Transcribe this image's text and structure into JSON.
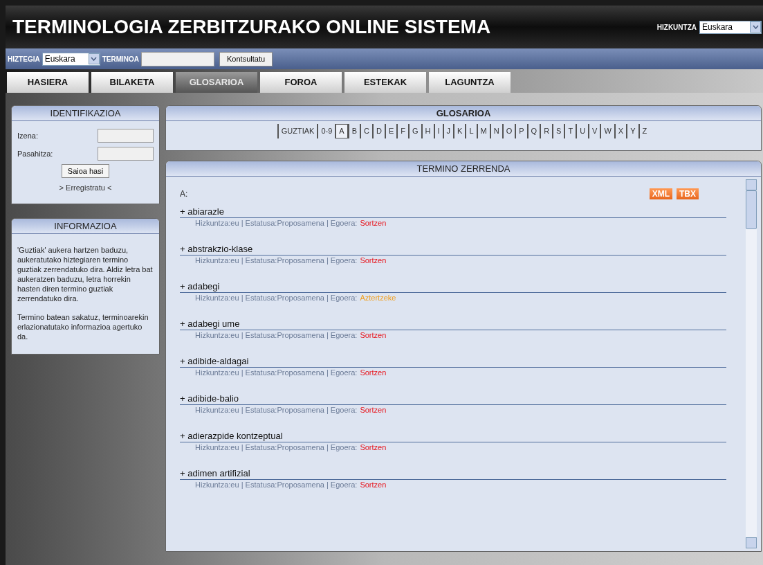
{
  "header": {
    "title": "TERMINOLOGIA ZERBITZURAKO ONLINE SISTEMA",
    "language_label": "HIZKUNTZA",
    "language_value": "Euskara"
  },
  "search_bar": {
    "dictionary_label": "HIZTEGIA",
    "dictionary_value": "Euskara",
    "term_label": "TERMINOA",
    "button": "Kontsultatu"
  },
  "tabs": [
    {
      "label": "HASIERA",
      "selected": false
    },
    {
      "label": "BILAKETA",
      "selected": false
    },
    {
      "label": "GLOSARIOA",
      "selected": true
    },
    {
      "label": "FOROA",
      "selected": false
    },
    {
      "label": "ESTEKAK",
      "selected": false
    },
    {
      "label": "LAGUNTZA",
      "selected": false
    }
  ],
  "login": {
    "title": "IDENTIFIKAZIOA",
    "name_label": "Izena:",
    "password_label": "Pasahitza:",
    "button": "Saioa hasi",
    "register_link": "> Erregistratu <"
  },
  "info": {
    "title": "INFORMAZIOA",
    "paragraphs": [
      "'Guztiak' aukera hartzen baduzu, aukeratutako hiztegiaren termino guztiak zerrendatuko dira. Aldiz letra bat aukeratzen baduzu, letra horrekin hasten diren termino guztiak zerrendatuko dira.",
      "Termino batean sakatuz, terminoarekin erlazionatutako informazioa agertuko da."
    ]
  },
  "glossary": {
    "title": "GLOSARIOA",
    "letters": [
      {
        "label": "GUZTIAK",
        "selected": false
      },
      {
        "label": "0-9",
        "selected": false
      },
      {
        "label": "A",
        "selected": true
      },
      {
        "label": "B",
        "selected": false
      },
      {
        "label": "C",
        "selected": false
      },
      {
        "label": "D",
        "selected": false
      },
      {
        "label": "E",
        "selected": false
      },
      {
        "label": "F",
        "selected": false
      },
      {
        "label": "G",
        "selected": false
      },
      {
        "label": "H",
        "selected": false
      },
      {
        "label": "I",
        "selected": false
      },
      {
        "label": "J",
        "selected": false
      },
      {
        "label": "K",
        "selected": false
      },
      {
        "label": "L",
        "selected": false
      },
      {
        "label": "M",
        "selected": false
      },
      {
        "label": "N",
        "selected": false
      },
      {
        "label": "O",
        "selected": false
      },
      {
        "label": "P",
        "selected": false
      },
      {
        "label": "Q",
        "selected": false
      },
      {
        "label": "R",
        "selected": false
      },
      {
        "label": "S",
        "selected": false
      },
      {
        "label": "T",
        "selected": false
      },
      {
        "label": "U",
        "selected": false
      },
      {
        "label": "V",
        "selected": false
      },
      {
        "label": "W",
        "selected": false
      },
      {
        "label": "X",
        "selected": false
      },
      {
        "label": "Y",
        "selected": false
      },
      {
        "label": "Z",
        "selected": false
      }
    ]
  },
  "term_list": {
    "title": "TERMINO ZERRENDA",
    "heading": "A:",
    "export_buttons": [
      "XML",
      "TBX"
    ],
    "terms": [
      {
        "term": "+ abiarazle",
        "meta": "Hizkuntza:eu | Estatusa:Proposamena | Egoera:",
        "status": "Sortzen",
        "color": "#e8141c"
      },
      {
        "term": "+ abstrakzio-klase",
        "meta": "Hizkuntza:eu | Estatusa:Proposamena | Egoera:",
        "status": "Sortzen",
        "color": "#e8141c"
      },
      {
        "term": "+ adabegi",
        "meta": "Hizkuntza:eu | Estatusa:Proposamena | Egoera:",
        "status": "Aztertzeke",
        "color": "#f0a020"
      },
      {
        "term": "+ adabegi ume",
        "meta": "Hizkuntza:eu | Estatusa:Proposamena | Egoera:",
        "status": "Sortzen",
        "color": "#e8141c"
      },
      {
        "term": "+ adibide-aldagai",
        "meta": "Hizkuntza:eu | Estatusa:Proposamena | Egoera:",
        "status": "Sortzen",
        "color": "#e8141c"
      },
      {
        "term": "+ adibide-balio",
        "meta": "Hizkuntza:eu | Estatusa:Proposamena | Egoera:",
        "status": "Sortzen",
        "color": "#e8141c"
      },
      {
        "term": "+ adierazpide kontzeptual",
        "meta": "Hizkuntza:eu | Estatusa:Proposamena | Egoera:",
        "status": "Sortzen",
        "color": "#e8141c"
      },
      {
        "term": "+ adimen artifizial",
        "meta": "Hizkuntza:eu | Estatusa:Proposamena | Egoera:",
        "status": "Sortzen",
        "color": "#e8141c"
      }
    ]
  }
}
